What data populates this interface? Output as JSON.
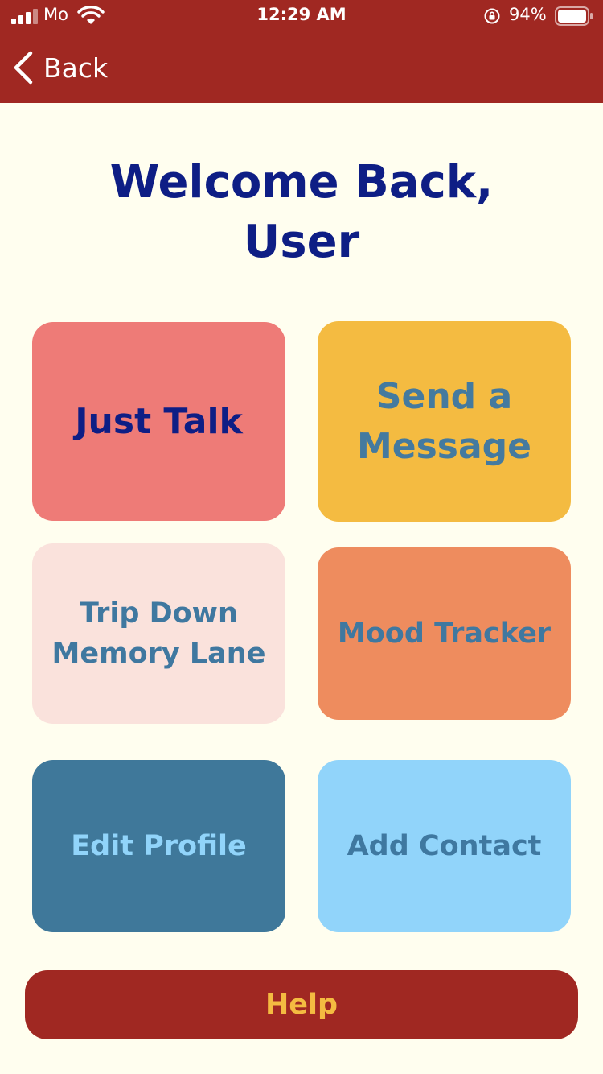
{
  "status_bar": {
    "carrier": "Mo",
    "time": "12:29 AM",
    "battery_percent": "94%",
    "icons": [
      "signal-icon",
      "wifi-icon",
      "rotation-lock-icon",
      "battery-icon"
    ]
  },
  "nav": {
    "back_label": "Back",
    "back_icon": "chevron-left-icon"
  },
  "welcome": {
    "line1": "Welcome Back,",
    "line2": "User"
  },
  "tiles": [
    {
      "lines": [
        "Just Talk"
      ],
      "bg": "#EE7B77",
      "fg": "#0E1E85"
    },
    {
      "lines": [
        "Send a",
        "Message"
      ],
      "bg": "#F4BB41",
      "fg": "#447A9F"
    },
    {
      "lines": [
        "Trip Down",
        "Memory Lane"
      ],
      "bg": "#FAE2DC",
      "fg": "#3F78A0"
    },
    {
      "lines": [
        "Mood Tracker"
      ],
      "bg": "#EE8C5E",
      "fg": "#3F78A0"
    },
    {
      "lines": [
        "Edit Profile"
      ],
      "bg": "#3F789A",
      "fg": "#91D4FA"
    },
    {
      "lines": [
        "Add Contact"
      ],
      "bg": "#91D4FA",
      "fg": "#3F78A0"
    }
  ],
  "help": {
    "label": "Help"
  },
  "colors": {
    "header": "#A02822",
    "background": "#FFFEEF",
    "title": "#0E1E85"
  }
}
